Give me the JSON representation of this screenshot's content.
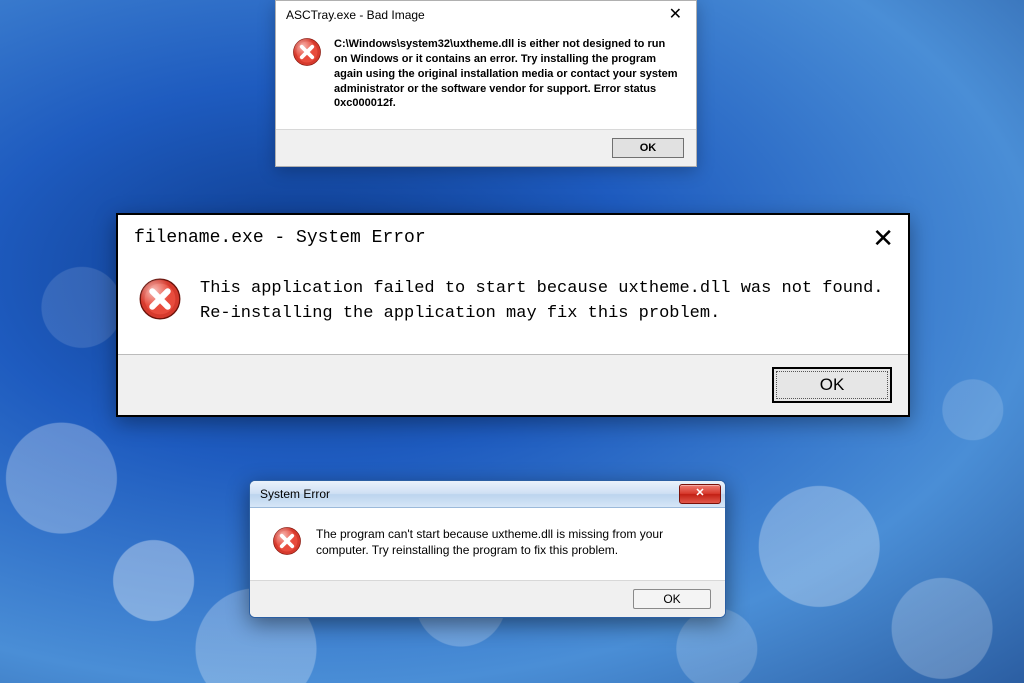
{
  "dialog1": {
    "title": "ASCTray.exe - Bad Image",
    "message": "C:\\Windows\\system32\\uxtheme.dll is either not designed to run on Windows or it contains an error. Try installing the program again using the original installation media or contact your system administrator or the software vendor for support. Error status 0xc000012f.",
    "ok_label": "OK",
    "close_glyph": "✕"
  },
  "dialog2": {
    "title": "filename.exe - System Error",
    "message": "This application failed to start because uxtheme.dll was not found. Re-installing the application may fix this problem.",
    "ok_label": "OK",
    "close_glyph": "✕"
  },
  "dialog3": {
    "title": "System Error",
    "message": "The program can't start because uxtheme.dll is missing from your computer. Try reinstalling the program to fix this problem.",
    "ok_label": "OK",
    "close_glyph": "✕"
  }
}
